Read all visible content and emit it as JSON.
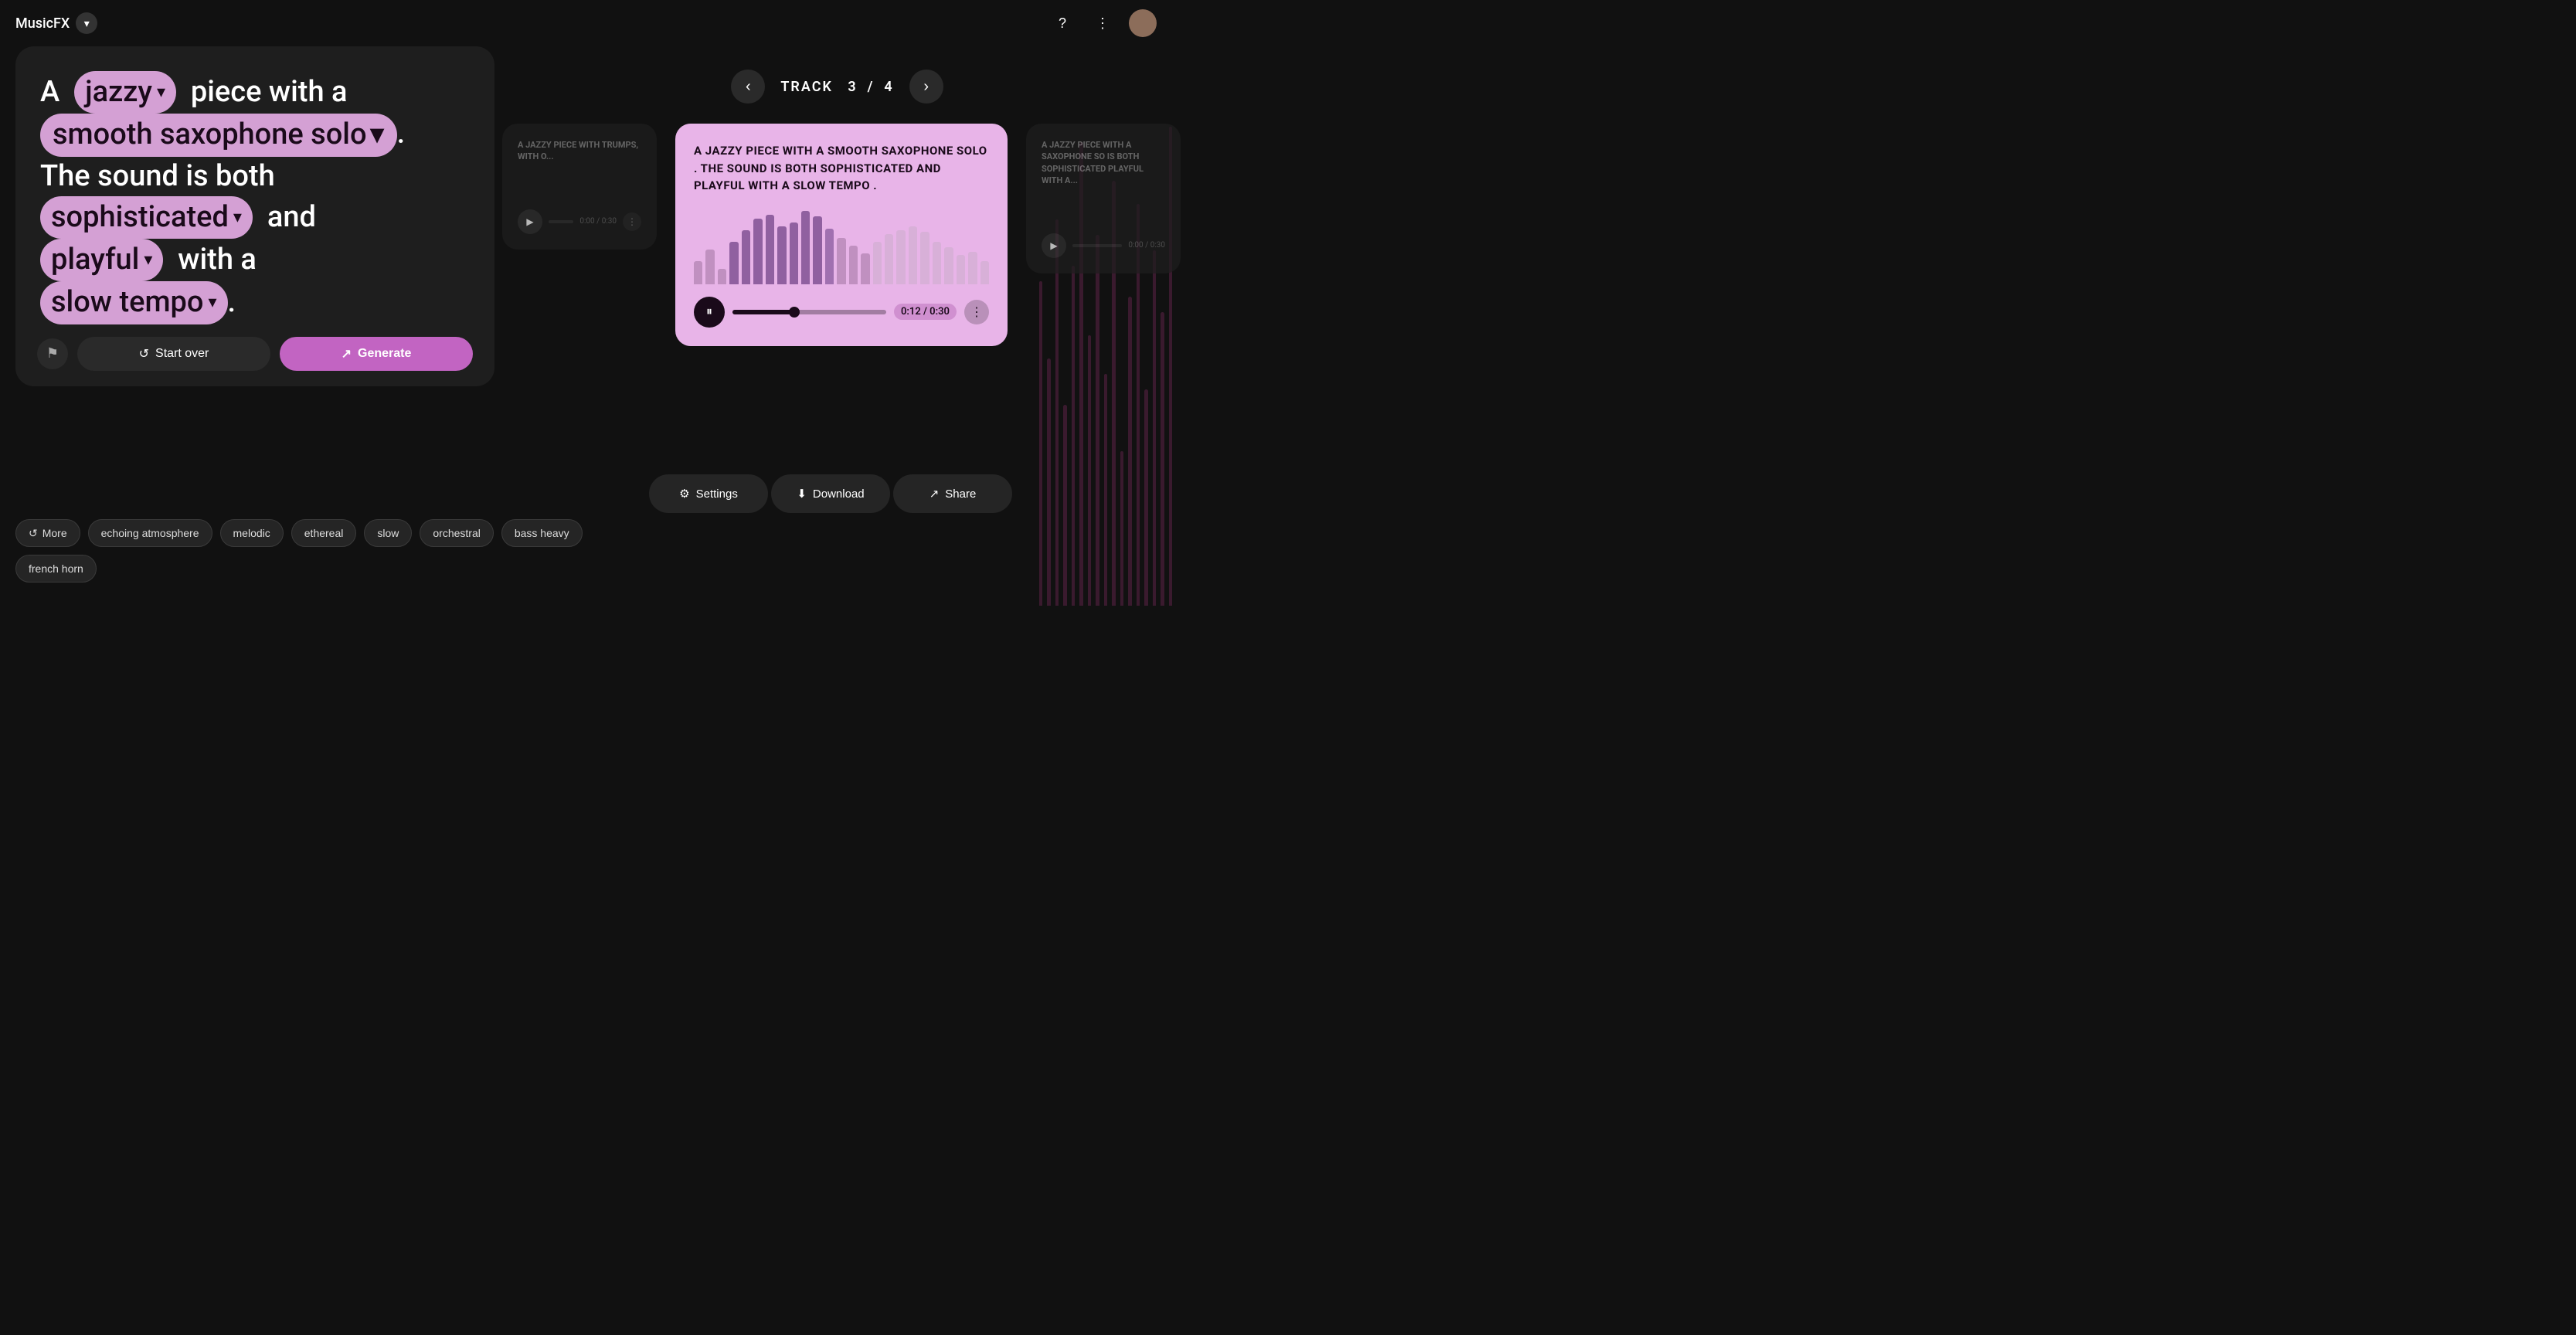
{
  "app": {
    "name": "MusicFX",
    "logo_btn_label": "▾"
  },
  "header": {
    "help_icon": "?",
    "more_icon": "⋮"
  },
  "prompt": {
    "prefix": "A",
    "chip1": "jazzy",
    "middle1": "piece with a",
    "chip2": "smooth saxophone solo",
    "period1": ".",
    "line2": "The sound is both",
    "chip3": "sophisticated",
    "and_text": "and",
    "chip4": "playful",
    "line3_pre": "with a",
    "chip5": "slow tempo",
    "period2": "."
  },
  "panel_actions": {
    "flag_icon": "⚑",
    "start_over": "Start over",
    "start_over_icon": "↺",
    "generate": "Generate",
    "generate_icon": "↗"
  },
  "track_nav": {
    "prev_icon": "‹",
    "next_icon": "›",
    "label": "TRACK",
    "current": "3",
    "separator": "/",
    "total": "4"
  },
  "track_main": {
    "text": "A JAZZY PIECE WITH A SMOOTH SAXOPHONE SOLO . THE SOUND IS BOTH SOPHISTICATED AND PLAYFUL WITH A SLOW TEMPO .",
    "time_current": "0:12",
    "time_total": "0:30",
    "time_display": "0:12 / 0:30",
    "progress_percent": 40
  },
  "track_partial_left": {
    "text": "A JAZZY PIECE WITH TRUMPS, WITH O...",
    "time_display": "0:00 / 0:30"
  },
  "track_partial_right": {
    "text": "A JAZZY PIECE WITH A SAXOPHONE SO IS BOTH SOPHISTICATED PLAYFUL WITH A...",
    "time_display": "0:00 / 0:30"
  },
  "action_bar": {
    "settings": "Settings",
    "settings_icon": "⚙",
    "download": "Download",
    "download_icon": "⬇",
    "share": "Share",
    "share_icon": "⬡"
  },
  "chips": {
    "more": "More",
    "more_icon": "↺",
    "items": [
      "echoing atmosphere",
      "melodic",
      "ethereal",
      "slow",
      "orchestral",
      "bass heavy",
      "french horn"
    ]
  },
  "colors": {
    "chip_bg": "#d4a0d4",
    "chip_text": "#1a0a1a",
    "card_bg": "#e8b4e8",
    "accent": "#c264c2"
  }
}
